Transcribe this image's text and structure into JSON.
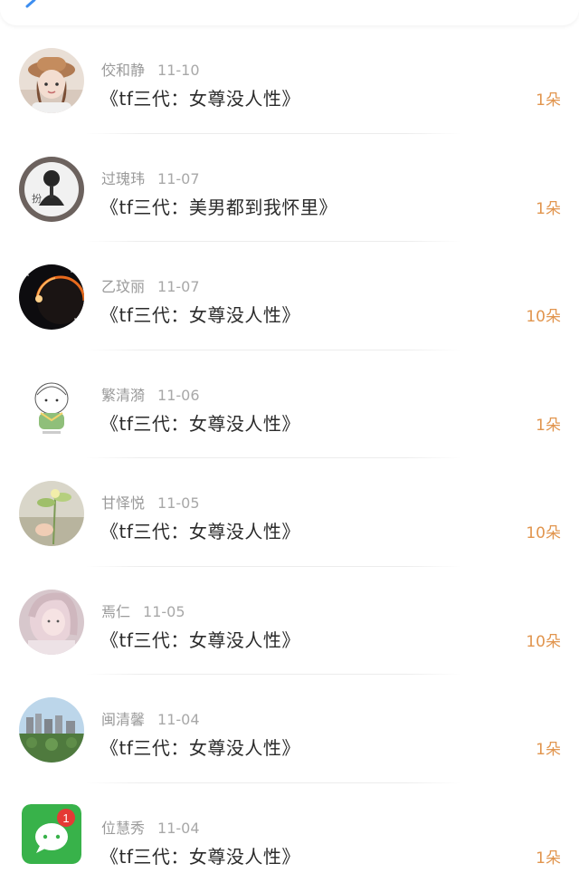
{
  "header": {
    "back_icon": "chevron-left-icon",
    "accent_color": "#3d8ef0"
  },
  "amount_color": "#e1954e",
  "rows": [
    {
      "name": "佼和静",
      "date": "11-10",
      "title": "《tf三代：女尊没人性》",
      "amount": "1朵"
    },
    {
      "name": "过瑰玮",
      "date": "11-07",
      "title": "《tf三代：美男都到我怀里》",
      "amount": "1朵"
    },
    {
      "name": "乙玟丽",
      "date": "11-07",
      "title": "《tf三代：女尊没人性》",
      "amount": "10朵"
    },
    {
      "name": "繁清漪",
      "date": "11-06",
      "title": "《tf三代：女尊没人性》",
      "amount": "1朵"
    },
    {
      "name": "甘怿悦",
      "date": "11-05",
      "title": "《tf三代：女尊没人性》",
      "amount": "10朵"
    },
    {
      "name": "焉仁",
      "date": "11-05",
      "title": "《tf三代：女尊没人性》",
      "amount": "10朵"
    },
    {
      "name": "闽清馨",
      "date": "11-04",
      "title": "《tf三代：女尊没人性》",
      "amount": "1朵"
    },
    {
      "name": "位慧秀",
      "date": "11-04",
      "title": "《tf三代：女尊没人性》",
      "amount": "1朵",
      "avatar_badge": "1"
    }
  ]
}
